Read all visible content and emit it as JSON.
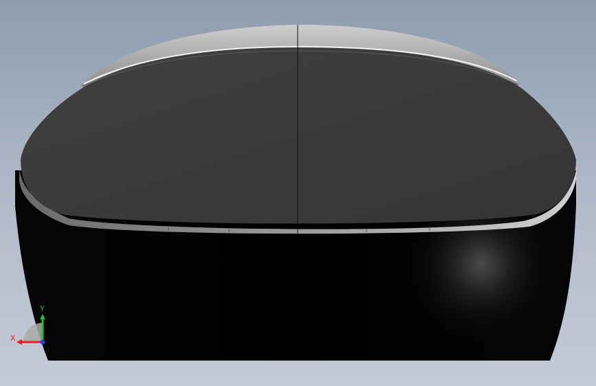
{
  "viewport": {
    "background_top": "#8e9cae",
    "background_bottom": "#c3cad6"
  },
  "model": {
    "body_color": "#000000",
    "top_face_color": "#3c3c3c",
    "rim_color": "#a7a7a7"
  },
  "triad": {
    "x_label": "X",
    "y_label": "Y",
    "x_color": "#e02020",
    "y_color": "#1fbf3a",
    "z_color": "#2a3fd8"
  }
}
